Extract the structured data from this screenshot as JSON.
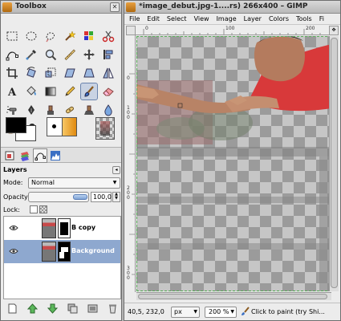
{
  "toolbox": {
    "title": "Toolbox",
    "close_glyph": "✕",
    "tools": [
      {
        "name": "rect-select-tool-icon"
      },
      {
        "name": "ellipse-select-tool-icon"
      },
      {
        "name": "free-select-tool-icon"
      },
      {
        "name": "fuzzy-select-tool-icon"
      },
      {
        "name": "color-select-tool-icon"
      },
      {
        "name": "scissors-tool-icon"
      },
      {
        "name": "paths-tool-icon"
      },
      {
        "name": "color-picker-tool-icon"
      },
      {
        "name": "zoom-tool-icon"
      },
      {
        "name": "measure-tool-icon"
      },
      {
        "name": "move-tool-icon"
      },
      {
        "name": "align-tool-icon"
      },
      {
        "name": "crop-tool-icon"
      },
      {
        "name": "rotate-tool-icon"
      },
      {
        "name": "scale-tool-icon"
      },
      {
        "name": "shear-tool-icon"
      },
      {
        "name": "perspective-tool-icon"
      },
      {
        "name": "flip-tool-icon"
      },
      {
        "name": "text-tool-icon"
      },
      {
        "name": "bucket-fill-tool-icon"
      },
      {
        "name": "blend-tool-icon"
      },
      {
        "name": "pencil-tool-icon"
      },
      {
        "name": "paintbrush-tool-icon"
      },
      {
        "name": "eraser-tool-icon"
      },
      {
        "name": "airbrush-tool-icon"
      },
      {
        "name": "ink-tool-icon"
      },
      {
        "name": "clone-tool-icon"
      },
      {
        "name": "heal-tool-icon"
      },
      {
        "name": "perspective-clone-tool-icon"
      },
      {
        "name": "blur-tool-icon"
      },
      {
        "name": "smudge-tool-icon"
      },
      {
        "name": "dodge-burn-tool-icon"
      }
    ],
    "colors": {
      "foreground": "#000000",
      "background": "#ffffff"
    }
  },
  "layers_panel": {
    "title": "Layers",
    "mode_label": "Mode:",
    "mode_value": "Normal",
    "opacity_label": "Opacity",
    "opacity_value": "100,0",
    "opacity_fraction": 1.0,
    "lock_label": "Lock:",
    "layers": [
      {
        "name": "B copy",
        "visible": true,
        "selected": false
      },
      {
        "name": "Background",
        "visible": true,
        "selected": true
      }
    ]
  },
  "image_window": {
    "title": "*image_debut.jpg-1....rs) 266x400 – GIMP",
    "menu": [
      "File",
      "Edit",
      "Select",
      "View",
      "Image",
      "Layer",
      "Colors",
      "Tools",
      "Fi"
    ],
    "ruler_h_labels": [
      "0",
      "100",
      "200"
    ],
    "ruler_v_labels": [
      "0",
      "100",
      "200",
      "300"
    ],
    "status": {
      "coords": "40,5, 232,0",
      "unit": "px",
      "zoom": "200 %",
      "message": "Click to paint (try Shi..."
    }
  },
  "colors": {
    "selection_blue": "#8ea8cf",
    "accent": "#6b84ad",
    "shirt_red": "#d8393a"
  }
}
